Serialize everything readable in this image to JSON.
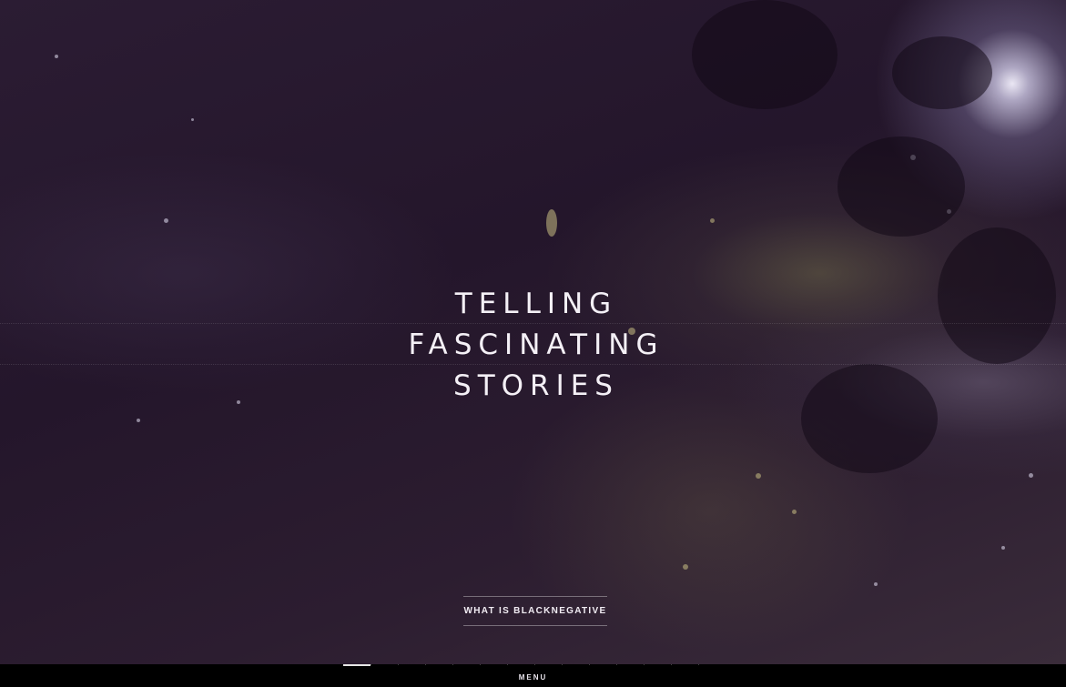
{
  "hero": {
    "headline": [
      "TELLING",
      "FASCINATING",
      "STORIES"
    ],
    "cta_label": "WHAT IS BLACKNEGATIVE"
  },
  "footer": {
    "menu_label": "MENU",
    "slide_count": 14,
    "active_slide": 1
  },
  "colors": {
    "overlay": "#24162b",
    "text": "#f4f0f6",
    "bar": "#000000"
  }
}
